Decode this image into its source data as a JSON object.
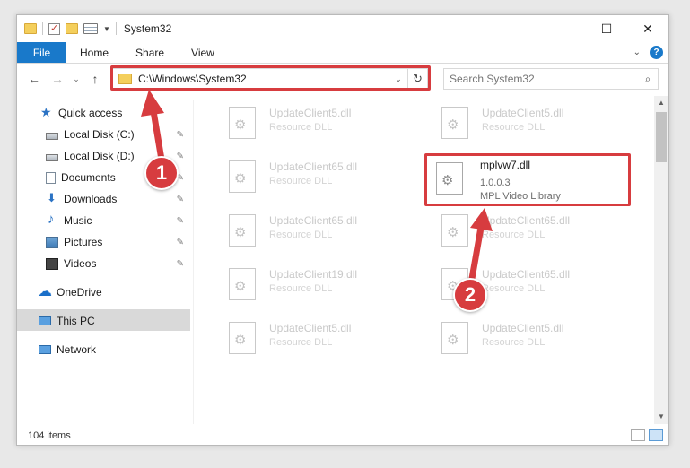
{
  "window": {
    "title": "System32",
    "controls": {
      "minimize": "—",
      "maximize": "☐",
      "close": "✕"
    }
  },
  "ribbon": {
    "tabs": [
      "File",
      "Home",
      "Share",
      "View"
    ],
    "help": "?"
  },
  "navbar": {
    "back": "←",
    "forward": "→",
    "recent": "⌄",
    "up": "↑",
    "address": "C:\\Windows\\System32",
    "refresh": "↻",
    "search_placeholder": "Search System32",
    "search_icon": "⌕"
  },
  "nav_pane": {
    "quick_access": "Quick access",
    "items": [
      {
        "label": "Local Disk (C:)",
        "icon": "disk-icon",
        "pinned": true
      },
      {
        "label": "Local Disk (D:)",
        "icon": "disk-icon",
        "pinned": true
      },
      {
        "label": "Documents",
        "icon": "documents-icon",
        "pinned": true
      },
      {
        "label": "Downloads",
        "icon": "download-icon",
        "pinned": true
      },
      {
        "label": "Music",
        "icon": "music-icon",
        "pinned": true
      },
      {
        "label": "Pictures",
        "icon": "pictures-icon",
        "pinned": true
      },
      {
        "label": "Videos",
        "icon": "videos-icon",
        "pinned": true
      }
    ],
    "onedrive": "OneDrive",
    "this_pc": "This PC",
    "network": "Network",
    "pin_glyph": "📌"
  },
  "files": [
    {
      "name": "UpdateClient5.dll",
      "desc": "Resource DLL"
    },
    {
      "name": "UpdateClient5.dll",
      "desc": "Resource DLL"
    },
    {
      "name": "UpdateClient65.dll",
      "desc": "Resource DLL"
    },
    {
      "name": "UpdateClient65.dll",
      "desc": "Resource DLL"
    },
    {
      "name": "UpdateClient65.dll",
      "desc": "Resource DLL"
    },
    {
      "name": "UpdateClient19.dll",
      "desc": "Resource DLL"
    },
    {
      "name": "UpdateClient65.dll",
      "desc": "Resource DLL"
    },
    {
      "name": "UpdateClient5.dll",
      "desc": "Resource DLL"
    },
    {
      "name": "UpdateClient5.dll",
      "desc": "Resource DLL"
    }
  ],
  "highlighted_file": {
    "name": "mplvw7.dll",
    "version": "1.0.0.3",
    "desc": "MPL Video Library"
  },
  "status": {
    "count": "104 items"
  },
  "annotations": {
    "step1": "1",
    "step2": "2",
    "color": "#d73c3f"
  }
}
